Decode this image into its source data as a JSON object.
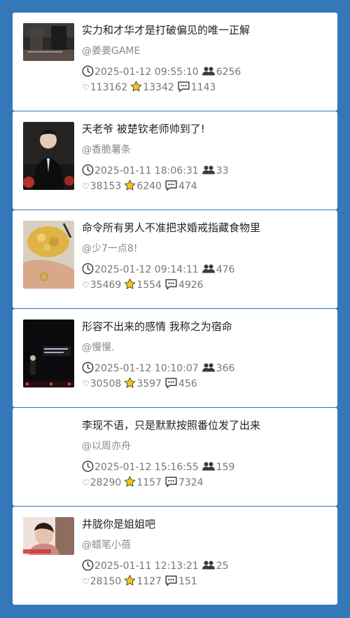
{
  "feed": [
    {
      "title": "实力和才华才是打破偏见的唯一正解",
      "author": "@姜姜GAME",
      "time": "2025-01-12 09:55:10",
      "viewers": "6256",
      "likes": "113162",
      "favorites": "13342",
      "comments": "1143",
      "has_thumb": true,
      "thumb": "dark-street-scene"
    },
    {
      "title": "天老爷 被楚钦老师帅到了!",
      "author": "@香脆薯条",
      "time": "2025-01-11 18:06:31",
      "viewers": "33",
      "likes": "38153",
      "favorites": "6240",
      "comments": "474",
      "has_thumb": true,
      "thumb": "man-in-black-suit"
    },
    {
      "title": "命令所有男人不准把求婚戒指藏食物里",
      "author": "@少7一点8!",
      "time": "2025-01-12 09:14:11",
      "viewers": "476",
      "likes": "35469",
      "favorites": "1554",
      "comments": "4926",
      "has_thumb": true,
      "thumb": "food-and-ring"
    },
    {
      "title": "形容不出来的感情 我称之为宿命",
      "author": "@慢慢.",
      "time": "2025-01-12 10:10:07",
      "viewers": "366",
      "likes": "30508",
      "favorites": "3597",
      "comments": "456",
      "has_thumb": true,
      "thumb": "stage-performance"
    },
    {
      "title": "李现不语，只是默默按照番位发了出来",
      "author": "@以周亦舟",
      "time": "2025-01-12 15:16:55",
      "viewers": "159",
      "likes": "28290",
      "favorites": "1157",
      "comments": "7324",
      "has_thumb": false,
      "thumb": ""
    },
    {
      "title": "井胧你是姐姐吧",
      "author": "@蜡笔小蓓",
      "time": "2025-01-11 12:13:21",
      "viewers": "25",
      "likes": "28150",
      "favorites": "1127",
      "comments": "151",
      "has_thumb": true,
      "thumb": "woman-portrait"
    }
  ],
  "icons": {
    "time": "clock-icon",
    "viewers": "people-icon",
    "likes": "heart-icon",
    "favorites": "star-icon",
    "comments": "comment-icon"
  },
  "colors": {
    "background": "#3478b9",
    "card": "#ffffff",
    "star": "#f5c518"
  }
}
